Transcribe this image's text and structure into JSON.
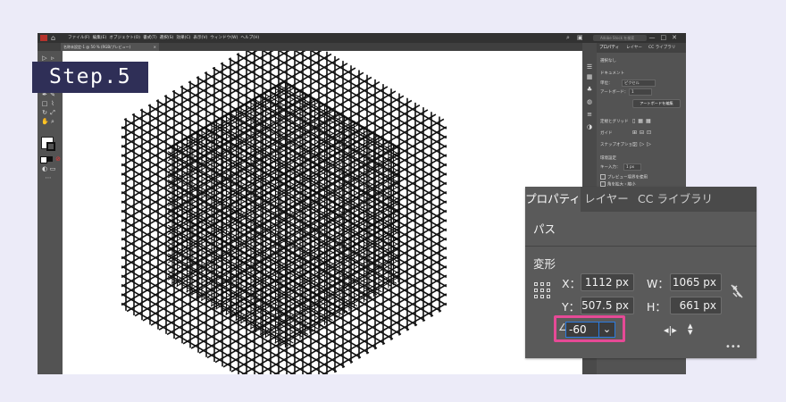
{
  "step_label": "Step.5",
  "app": {
    "menu_items": [
      "ファイル(F)",
      "編集(E)",
      "オブジェクト(O)",
      "書式(T)",
      "選択(S)",
      "効果(C)",
      "表示(V)",
      "ウィンドウ(W)",
      "ヘルプ(H)"
    ],
    "doc_tab": "名称未設定-1 @ 50 % (RGB/プレビュー)",
    "search_placeholder": "Adobe Stock を検索",
    "window_controls": [
      "—",
      "□",
      "✕"
    ]
  },
  "small_panel": {
    "tabs": [
      "プロパティ",
      "レイヤー",
      "CC ライブラリ"
    ],
    "no_selection": "選択なし",
    "document_heading": "ドキュメント",
    "unit_label": "単位：",
    "unit_value": "ピクセル",
    "artboard_label": "アートボード：",
    "artboard_value": "1",
    "edit_artboard_button": "アートボードを編集",
    "rulers_grids": "定規とグリッド",
    "guides": "ガイド",
    "snap_options": "スナップオプション",
    "preferences": "環境設定",
    "key_increment_label": "キー入力：",
    "key_increment_value": "1 px",
    "preview_bounds": "プレビュー境界を使用",
    "scale_corners": "角を拡大・縮小"
  },
  "zoom_panel": {
    "tabs": [
      "プロパティ",
      "レイヤー",
      "CC ライブラリ"
    ],
    "object_type": "パス",
    "section_transform": "変形",
    "x_label": "X：",
    "x_value": "1112 px",
    "y_label": "Y：",
    "y_value": "507.5 px",
    "w_label": "W：",
    "w_value": "1065 px",
    "h_label": "H：",
    "h_value": "661 px",
    "angle_value": "-60",
    "more": "•••"
  },
  "colors": {
    "step_bg": "#2f2f57",
    "highlight": "#e64a96",
    "focus": "#2a7be0",
    "page_bg": "#ecebf8"
  }
}
